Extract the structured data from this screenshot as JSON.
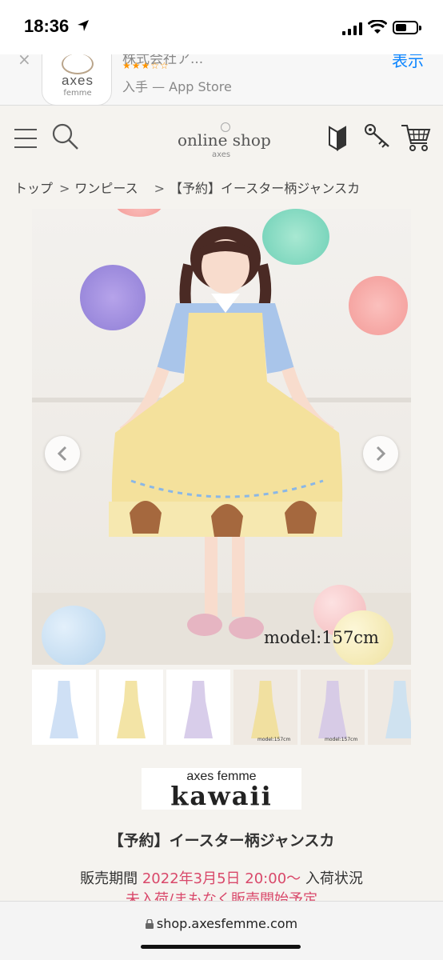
{
  "status_bar": {
    "time": "18:36"
  },
  "app_banner": {
    "close": "×",
    "app_name": "株式会社ア...",
    "stars": "★★★☆☆",
    "store_text": "入手 — App Store",
    "view_label": "表示",
    "icon_text": "axes",
    "icon_sub": "femme"
  },
  "header": {
    "logo": "online shop",
    "logo_sub": "axes"
  },
  "breadcrumb": [
    "トップ",
    "ワンピース",
    "【予約】イースター柄ジャンスカ"
  ],
  "breadcrumb_sep": ">",
  "hero": {
    "caption": "model:157cm"
  },
  "thumbnails": [
    {
      "name": "thumb-blue-dress",
      "color": "#cfe0f5"
    },
    {
      "name": "thumb-yellow-dress",
      "color": "#f3e4a6"
    },
    {
      "name": "thumb-lavender-dress",
      "color": "#d8cdea"
    },
    {
      "name": "thumb-model-yellow",
      "color": "#f1e0a0"
    },
    {
      "name": "thumb-model-lavender",
      "color": "#d7cbe6"
    },
    {
      "name": "thumb-model-blue",
      "color": "#cfe2f0"
    }
  ],
  "thumb_captions": [
    "model:157cm",
    "model:157cm"
  ],
  "brand": {
    "name": "axes femme",
    "line": "kawaii"
  },
  "product": {
    "title": "【予約】イースター柄ジャンスカ",
    "sale_label": "販売期間",
    "sale_date": "2022年3月5日 20:00〜",
    "stock_label": "入荷状況",
    "stock_status": "未入荷/まもなく販売開始予定"
  },
  "url_bar": {
    "url": "shop.axesfemme.com"
  },
  "colors": {
    "accent": "#d9486a",
    "link": "#0a84ff"
  }
}
